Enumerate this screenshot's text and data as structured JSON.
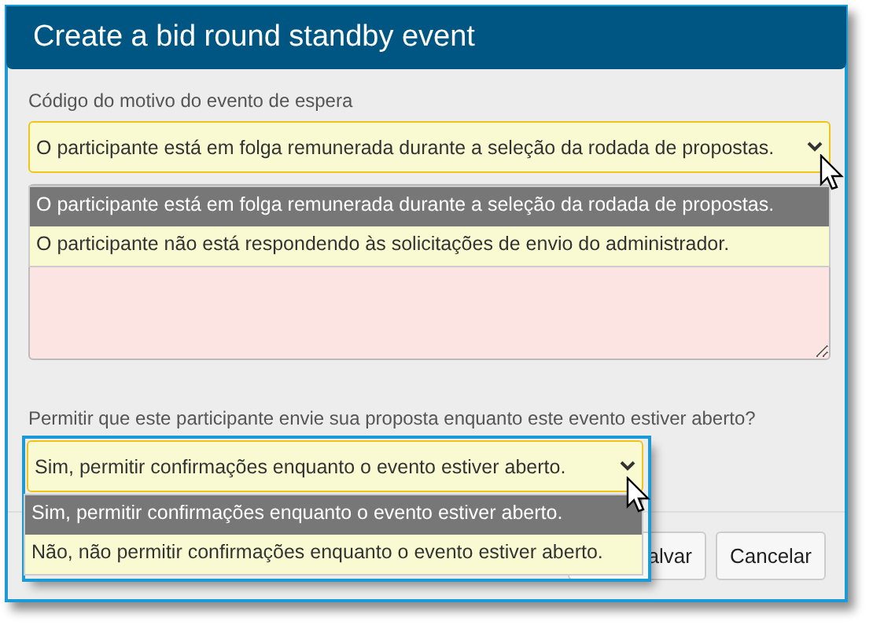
{
  "dialog": {
    "title": "Create a bid round standby event"
  },
  "selects": [
    {
      "label": "Código do motivo do evento de espera",
      "value": "O participante está em folga remunerada durante a seleção da rodada de propostas.",
      "open": true,
      "focused": false,
      "options": [
        {
          "label": "O participante está em folga remunerada durante a seleção da rodada de propostas.",
          "selected": true
        },
        {
          "label": "O participante não está respondendo às solicitações de envio do administrador.",
          "selected": false
        }
      ]
    },
    {
      "label": "Permitir que este participante envie sua proposta enquanto este evento estiver aberto?",
      "value": "Sim, permitir confirmações enquanto o evento estiver aberto.",
      "open": true,
      "focused": true,
      "options": [
        {
          "label": "Sim, permitir confirmações enquanto o evento estiver aberto.",
          "selected": true
        },
        {
          "label": "Não, não permitir confirmações enquanto o evento estiver aberto.",
          "selected": false
        }
      ]
    }
  ],
  "notes": {
    "invalid": true
  },
  "buttons": [
    {
      "label": "alvar"
    },
    {
      "label": "Cancelar"
    }
  ]
}
